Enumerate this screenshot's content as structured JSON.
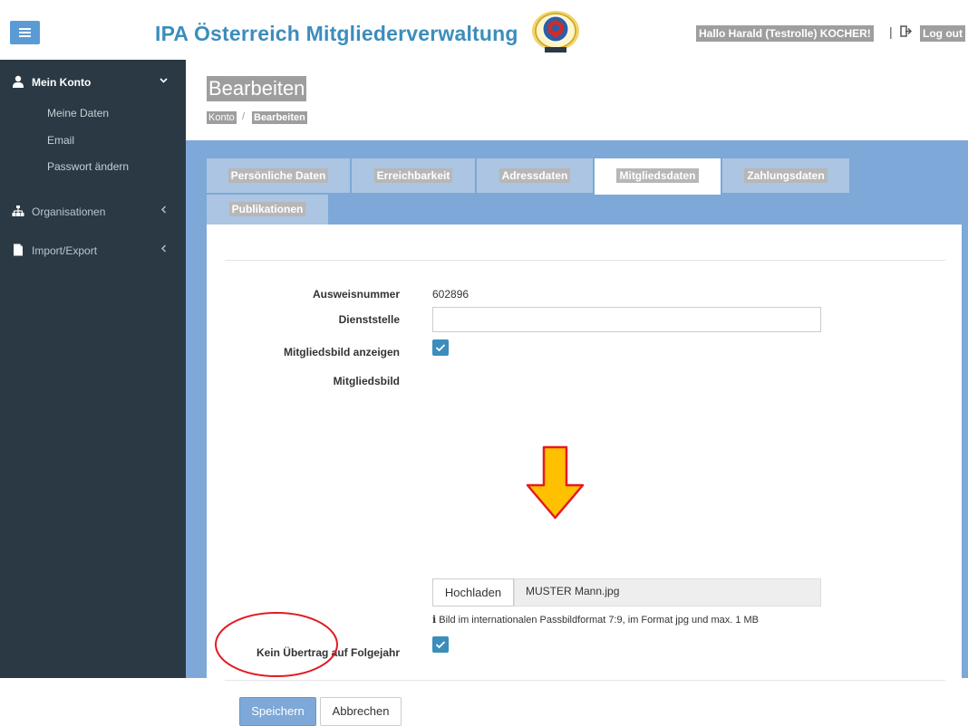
{
  "header": {
    "title": "IPA Österreich Mitgliederverwaltung",
    "greeting": "Hallo Harald (Testrolle) KOCHER!",
    "separator": "|",
    "logout_label": "Log out"
  },
  "sidebar": {
    "items": [
      {
        "label": "Mein Konto",
        "icon": "user-icon",
        "expanded": true
      },
      {
        "label": "Organisationen",
        "icon": "sitemap-icon"
      },
      {
        "label": "Import/Export",
        "icon": "file-icon"
      }
    ],
    "sub_items": [
      "Meine Daten",
      "Email",
      "Passwort ändern"
    ]
  },
  "page": {
    "title": "Bearbeiten",
    "breadcrumb": [
      "Konto",
      "/",
      "Bearbeiten"
    ]
  },
  "tabs": [
    {
      "label": "Persönliche Daten"
    },
    {
      "label": "Erreichbarkeit"
    },
    {
      "label": "Adressdaten"
    },
    {
      "label": "Mitgliedsdaten",
      "active": true
    },
    {
      "label": "Zahlungsdaten"
    },
    {
      "label": "Publikationen"
    }
  ],
  "form": {
    "ausweisnummer_label": "Ausweisnummer",
    "ausweisnummer_value": "602896",
    "dienststelle_label": "Dienststelle",
    "dienststelle_value": "",
    "bild_anzeigen_label": "Mitgliedsbild anzeigen",
    "bild_anzeigen_checked": true,
    "bild_label": "Mitgliedsbild",
    "upload_label": "Hochladen",
    "file_name": "MUSTER Mann.jpg",
    "help_text": "Bild im internationalen Passbildformat 7:9, im Format jpg und max. 1 MB",
    "kein_uebertrag_label": "Kein Übertrag auf Folgejahr",
    "kein_uebertrag_checked": true
  },
  "actions": {
    "save_label": "Speichern",
    "cancel_label": "Abbrechen"
  },
  "colors": {
    "accent": "#3c8dbc",
    "sidebar": "#2a3943",
    "band": "#7da8d8",
    "annotation_arrow": "#ffc000",
    "annotation_circle": "#e31b23"
  }
}
